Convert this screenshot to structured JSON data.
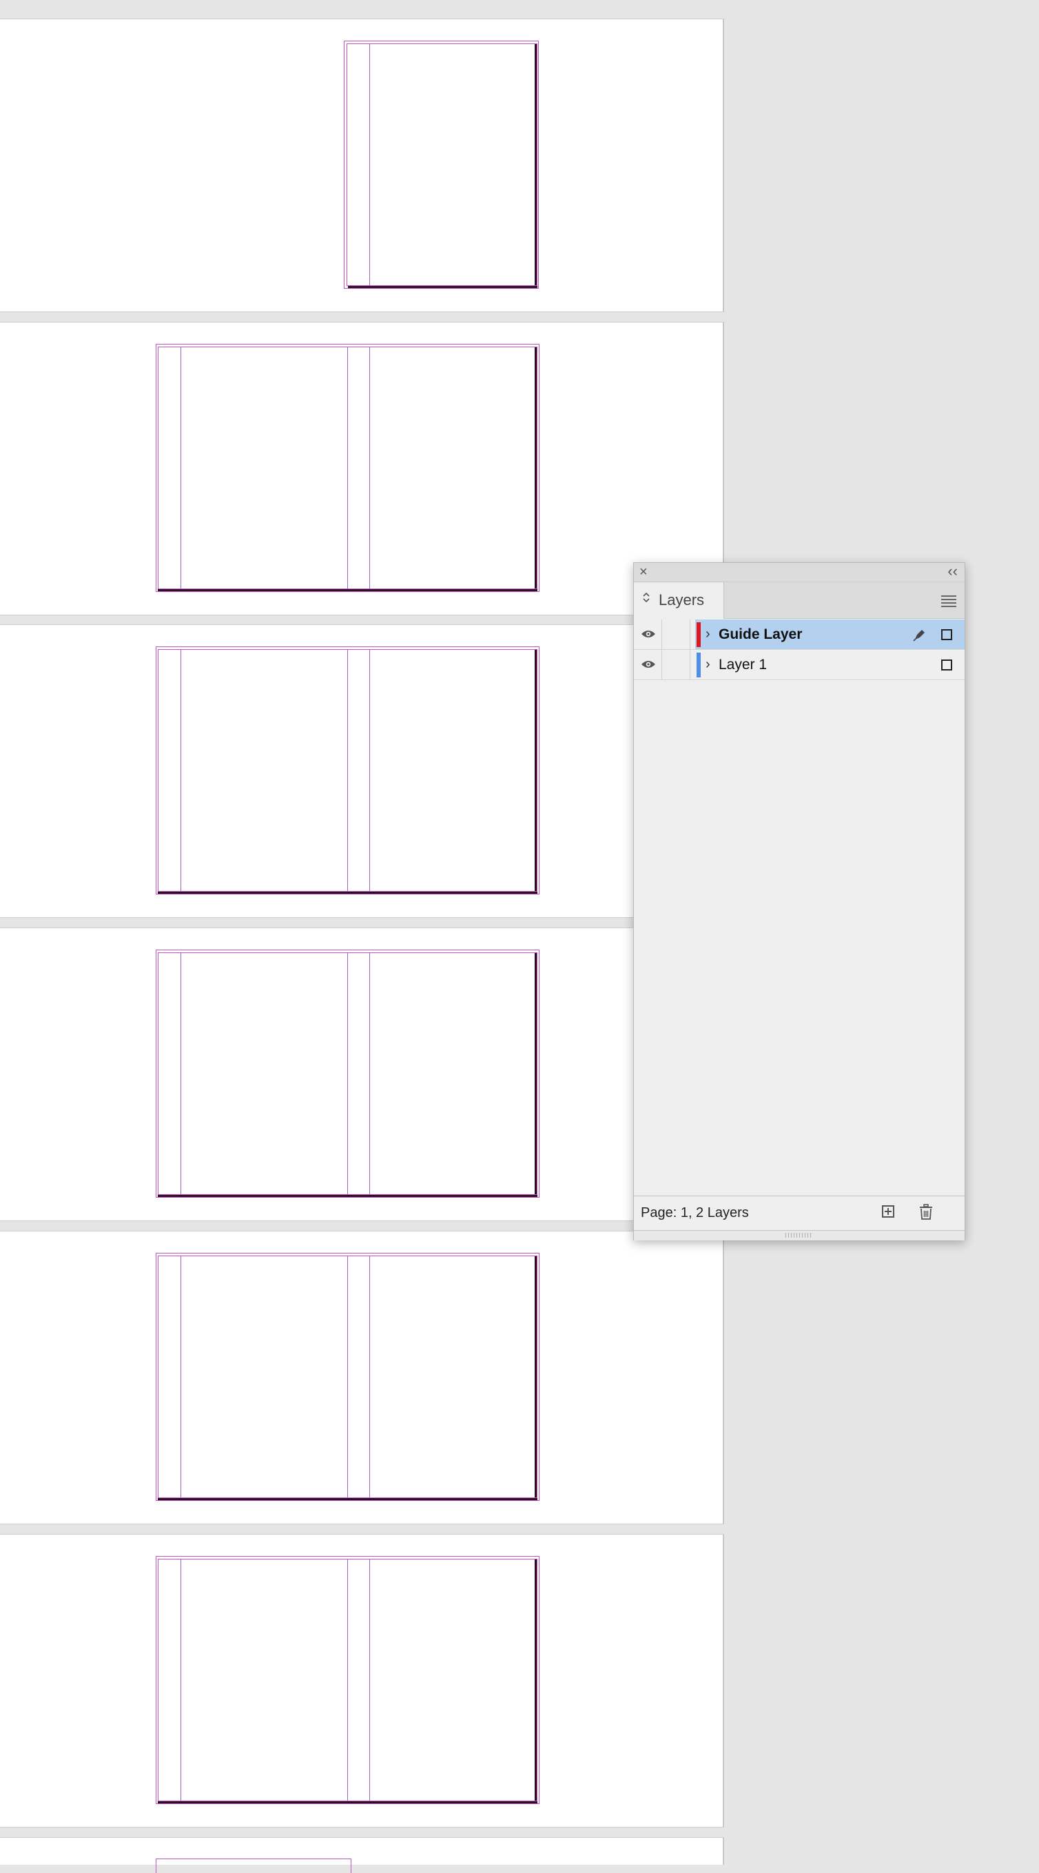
{
  "layers_panel": {
    "close_icon": "close-icon",
    "collapse_label": "‹‹",
    "tab_arrows": "◇",
    "tab_label": "Layers",
    "menu_icon": "hamburger-icon",
    "layers": [
      {
        "name": "Guide Layer",
        "color": "#e0161e",
        "visible": true,
        "selected": true,
        "has_pen": true
      },
      {
        "name": "Layer 1",
        "color": "#4d8fe8",
        "visible": true,
        "selected": false,
        "has_pen": false
      }
    ],
    "status": "Page: 1, 2 Layers",
    "new_layer_icon": "new-layer-icon",
    "delete_icon": "trash-icon"
  },
  "colors": {
    "pasteboard": "#e5e5e5",
    "margin_guides": "#c154c1",
    "page_shadow": "#2a0f22",
    "selection": "#b3d0ef"
  }
}
